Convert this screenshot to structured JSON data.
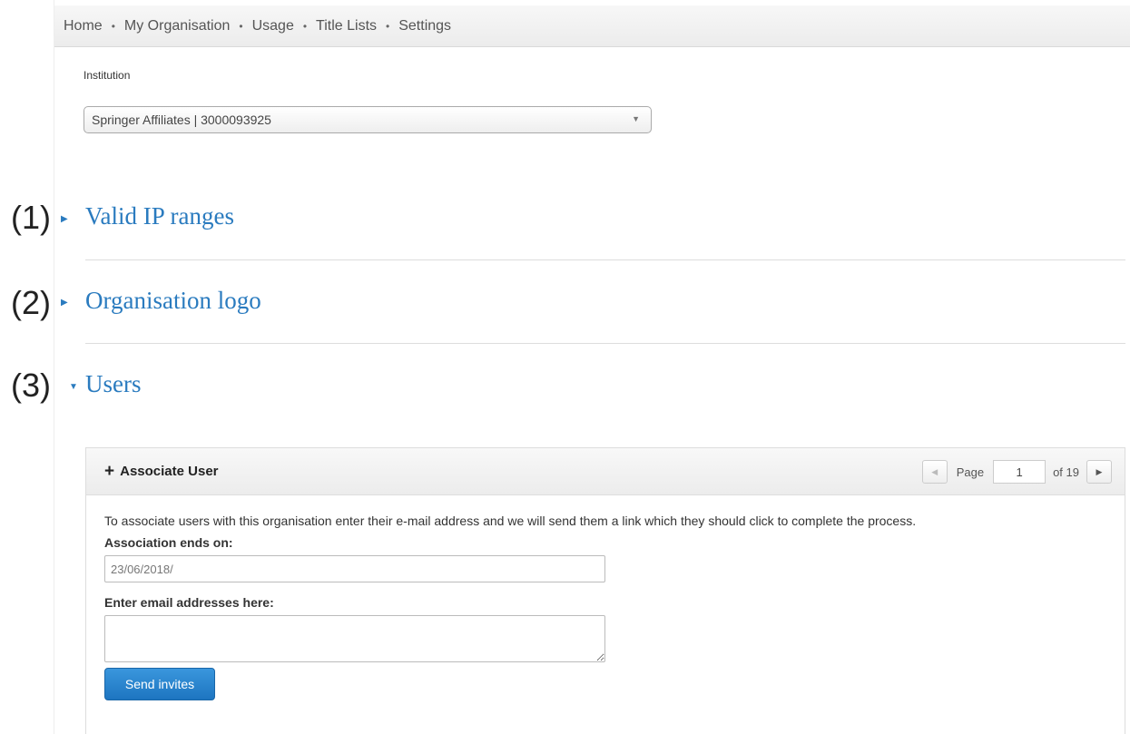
{
  "nav": {
    "items": [
      "Home",
      "My Organisation",
      "Usage",
      "Title Lists",
      "Settings"
    ],
    "separator": "•"
  },
  "institution": {
    "label": "Institution",
    "selected": "Springer Affiliates | 3000093925"
  },
  "markers": [
    "(1)",
    "(2)",
    "(3)"
  ],
  "sections": [
    {
      "title": "Valid IP ranges",
      "expanded": false
    },
    {
      "title": "Organisation logo",
      "expanded": false
    },
    {
      "title": "Users",
      "expanded": true
    }
  ],
  "users_panel": {
    "associate_label": "Associate User",
    "pager": {
      "page_label": "Page",
      "current_page": "1",
      "of_label": "of 19"
    },
    "instructions": "To associate users with this organisation enter their e-mail address and we will send them a link which they should click to complete the process.",
    "ends_label": "Association ends on:",
    "ends_value": "23/06/2018/",
    "email_label": "Enter email addresses here:",
    "send_label": "Send invites"
  },
  "colors": {
    "link": "#2a7bbf",
    "button": "#1d75c0"
  },
  "icons": {
    "collapsed": "caret-right-icon",
    "expanded": "caret-down-icon",
    "add": "plus-icon"
  }
}
